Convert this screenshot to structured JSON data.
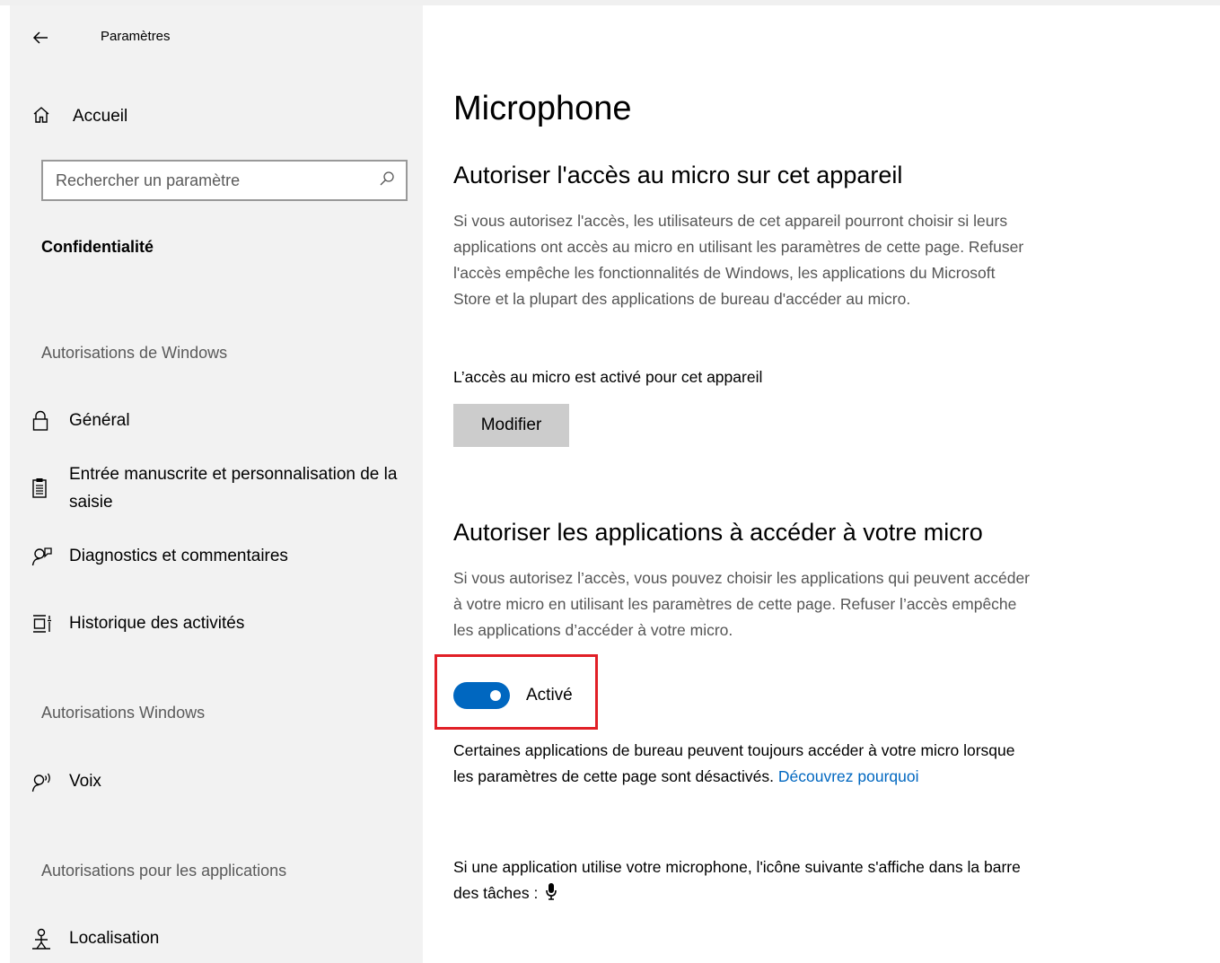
{
  "window": {
    "app_title": "Paramètres"
  },
  "sidebar": {
    "home_label": "Accueil",
    "search": {
      "placeholder": "Rechercher un paramètre",
      "value": ""
    },
    "section_title": "Confidentialité",
    "groups": [
      {
        "header": "Autorisations de Windows",
        "items": [
          {
            "label": "Général",
            "icon": "lock-icon"
          },
          {
            "label": "Entrée manuscrite et personnalisation de la saisie",
            "icon": "clipboard-icon"
          },
          {
            "label": "Diagnostics et commentaires",
            "icon": "person-feedback-icon"
          },
          {
            "label": "Historique des activités",
            "icon": "timeline-icon"
          }
        ]
      },
      {
        "header": "Autorisations Windows",
        "items": [
          {
            "label": "Voix",
            "icon": "person-voice-icon"
          }
        ]
      },
      {
        "header": "Autorisations pour les applications",
        "items": [
          {
            "label": "Localisation",
            "icon": "location-person-icon"
          }
        ]
      }
    ]
  },
  "main": {
    "page_title": "Microphone",
    "device_section": {
      "heading": "Autoriser l'accès au micro sur cet appareil",
      "description": "Si vous autorisez l'accès, les utilisateurs de cet appareil pourront choisir si leurs applications ont accès au micro en utilisant les paramètres de cette page. Refuser l'accès empêche les fonctionnalités de Windows, les applications du Microsoft Store et la plupart des applications de bureau d'accéder au micro.",
      "status": "L’accès au micro est activé pour cet appareil",
      "button_label": "Modifier"
    },
    "apps_section": {
      "heading": "Autoriser les applications à accéder à votre micro",
      "description": "Si vous autorisez l’accès, vous pouvez choisir les applications qui peuvent accéder à votre micro en utilisant les paramètres de cette page. Refuser l’accès empêche les applications d’accéder à votre micro.",
      "toggle_state": "on",
      "toggle_label": "Activé",
      "note_text": "Certaines applications de bureau peuvent toujours accéder à votre micro lorsque les paramètres de cette page sont désactivés. ",
      "note_link": "Découvrez pourquoi",
      "taskbar_text": "Si une application utilise votre microphone, l'icône suivante s'affiche dans la barre des tâches :"
    }
  },
  "colors": {
    "sidebar_bg": "#f2f2f2",
    "accent": "#0067c0",
    "highlight": "#e11f26",
    "button_bg": "#cccccc"
  }
}
